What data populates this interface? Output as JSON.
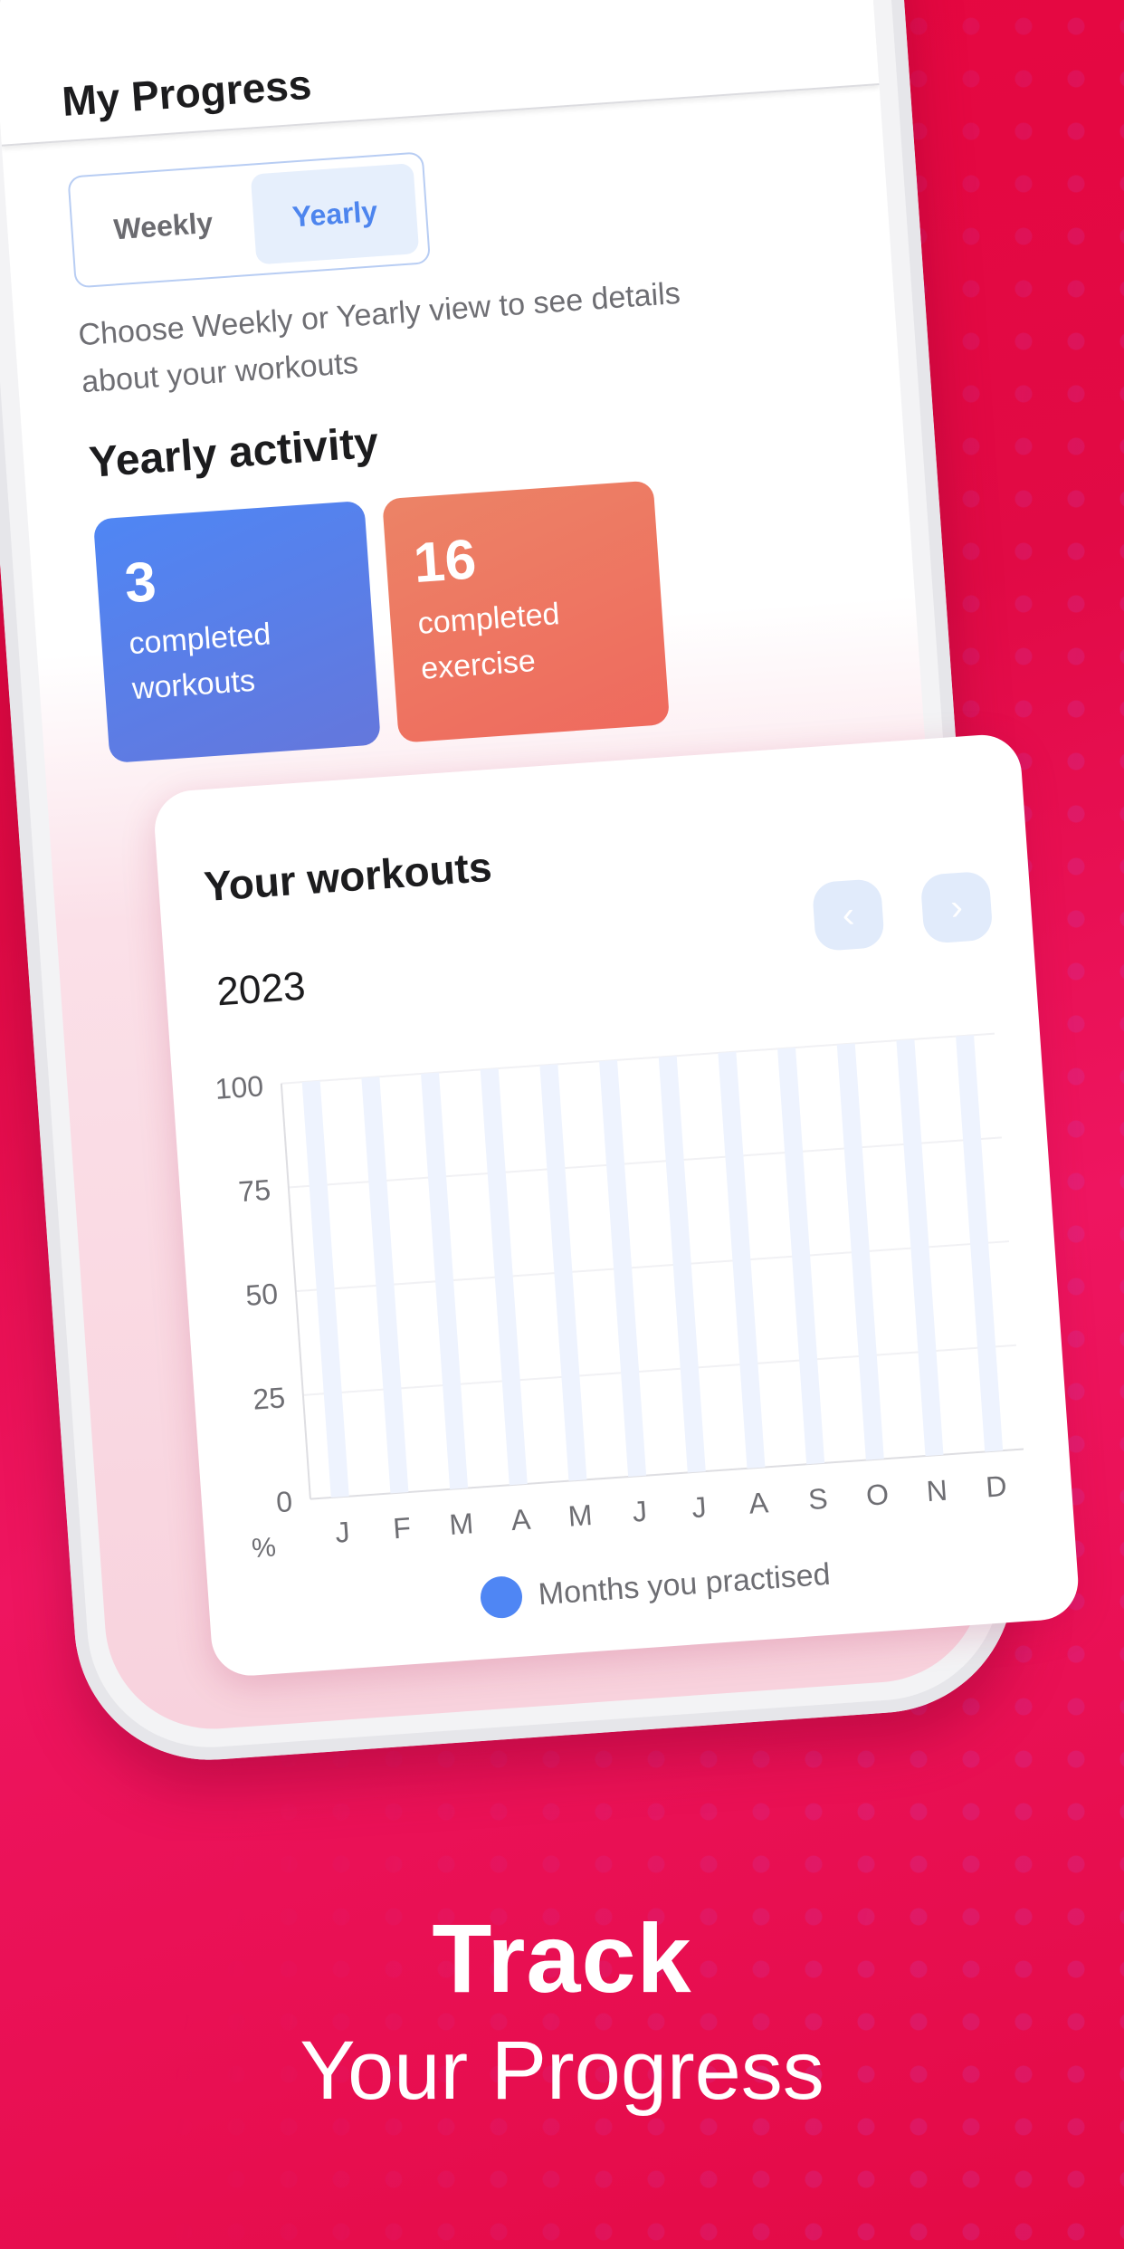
{
  "app": {
    "header_title": "My Progress",
    "segment": {
      "options": [
        "Weekly",
        "Yearly"
      ],
      "selected": "Yearly"
    },
    "helper_text": "Choose Weekly or Yearly view to see details about your workouts",
    "yearly_activity": {
      "title": "Yearly activity",
      "stats": [
        {
          "value": "3",
          "label": "completed workouts",
          "color": "#4f86f4"
        },
        {
          "value": "16",
          "label": "completed exercise",
          "color": "#ec7a62"
        }
      ]
    },
    "workouts_card": {
      "title": "Your workouts",
      "year": "2023",
      "prev_icon": "chevron-left-icon",
      "next_icon": "chevron-right-icon",
      "prev_glyph": "‹",
      "next_glyph": "›"
    }
  },
  "promo": {
    "line1": "Track",
    "line2": "Your Progress"
  },
  "colors": {
    "background": "#e10a45",
    "accent_blue": "#4f86f4",
    "accent_orange": "#ec7a62",
    "bar_track": "#eef3fe"
  },
  "chart_data": {
    "type": "bar",
    "title": "Your workouts",
    "subtitle": "2023",
    "categories": [
      "J",
      "F",
      "M",
      "A",
      "M",
      "J",
      "J",
      "A",
      "S",
      "O",
      "N",
      "D"
    ],
    "series": [
      {
        "name": "Months you practised",
        "values": [
          0,
          0,
          0,
          0,
          0,
          0,
          0,
          0,
          0,
          0,
          0,
          0
        ]
      }
    ],
    "track_max": 100,
    "xlabel": "",
    "ylabel": "%",
    "yticks": [
      0,
      25,
      50,
      75,
      100
    ],
    "ylim": [
      0,
      100
    ],
    "grid": true,
    "legend": "bottom-center"
  }
}
